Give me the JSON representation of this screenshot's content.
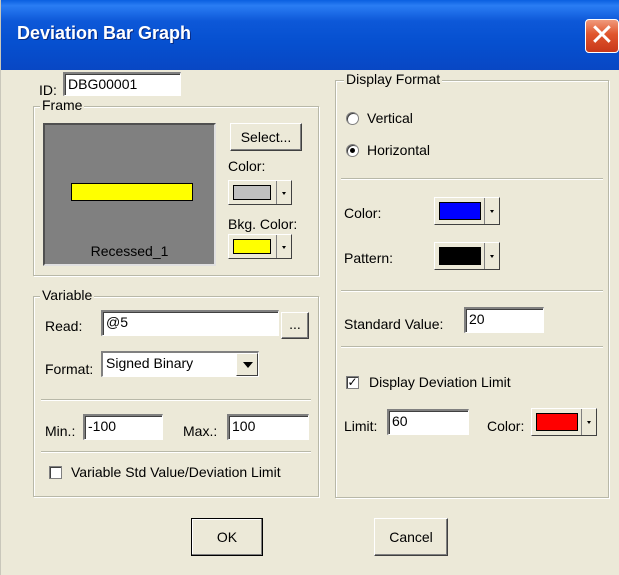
{
  "window": {
    "title": "Deviation Bar Graph",
    "close_glyph": "✕"
  },
  "id_field": {
    "label": "ID:",
    "value": "DBG00001"
  },
  "frame": {
    "group_label": "Frame",
    "preview_name": "Recessed_1",
    "select_label": "Select...",
    "color_label": "Color:",
    "color_value": "#c0c0c0",
    "bkg_color_label": "Bkg. Color:",
    "bkg_color_value": "#ffff00",
    "preview_bg": "#808080",
    "preview_bar": "#ffff00"
  },
  "variable": {
    "group_label": "Variable",
    "read_label": "Read:",
    "read_value": "@5",
    "browse_label": "...",
    "format_label": "Format:",
    "format_value": "Signed Binary",
    "min_label": "Min.:",
    "min_value": "-100",
    "max_label": "Max.:",
    "max_value": "100",
    "std_checkbox_label": "Variable Std Value/Deviation Limit",
    "std_checked": false
  },
  "display_format": {
    "group_label": "Display Format",
    "vertical_label": "Vertical",
    "horizontal_label": "Horizontal",
    "selected": "horizontal",
    "color_label": "Color:",
    "color_value": "#0000ff",
    "pattern_label": "Pattern:",
    "pattern_value": "#000000",
    "standard_value_label": "Standard Value:",
    "standard_value": "20",
    "deviation_checkbox_label": "Display Deviation Limit",
    "deviation_checked": true,
    "limit_label": "Limit:",
    "limit_value": "60",
    "limit_color_label": "Color:",
    "limit_color_value": "#ff0000"
  },
  "buttons": {
    "ok_label": "OK",
    "cancel_label": "Cancel"
  }
}
